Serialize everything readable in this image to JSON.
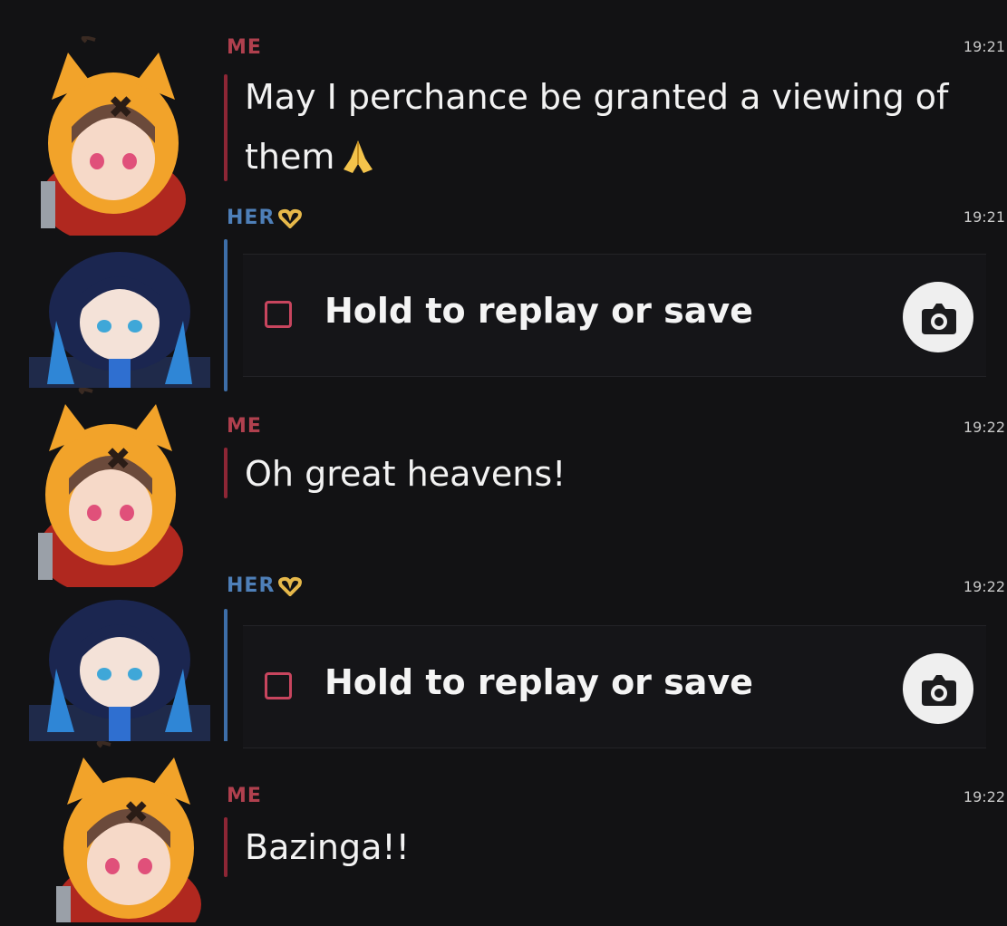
{
  "messages": [
    {
      "sender": "ME",
      "time": "19:21",
      "text_line1": "May I perchance be granted a viewing of",
      "text_line2": "them"
    },
    {
      "sender": "HER",
      "time": "19:21",
      "snap_label": "Hold to replay or save"
    },
    {
      "sender": "ME",
      "time": "19:22",
      "text": "Oh great heavens!"
    },
    {
      "sender": "HER",
      "time": "19:22",
      "snap_label": "Hold to replay or save"
    },
    {
      "sender": "ME",
      "time": "19:22",
      "text": "Bazinga!!"
    }
  ],
  "icons": {
    "emoji_after_text": "folded-hands-icon",
    "emoji_after_her": "heart-hands-icon",
    "snap_indicator": "unopened-snap-square-icon",
    "camera": "camera-icon"
  },
  "colors": {
    "background": "#121214",
    "me": "#b0404e",
    "her": "#4e7fb8",
    "me_bar": "#8d2635",
    "her_bar": "#3d6ea8",
    "snap_square": "#c8455e"
  }
}
